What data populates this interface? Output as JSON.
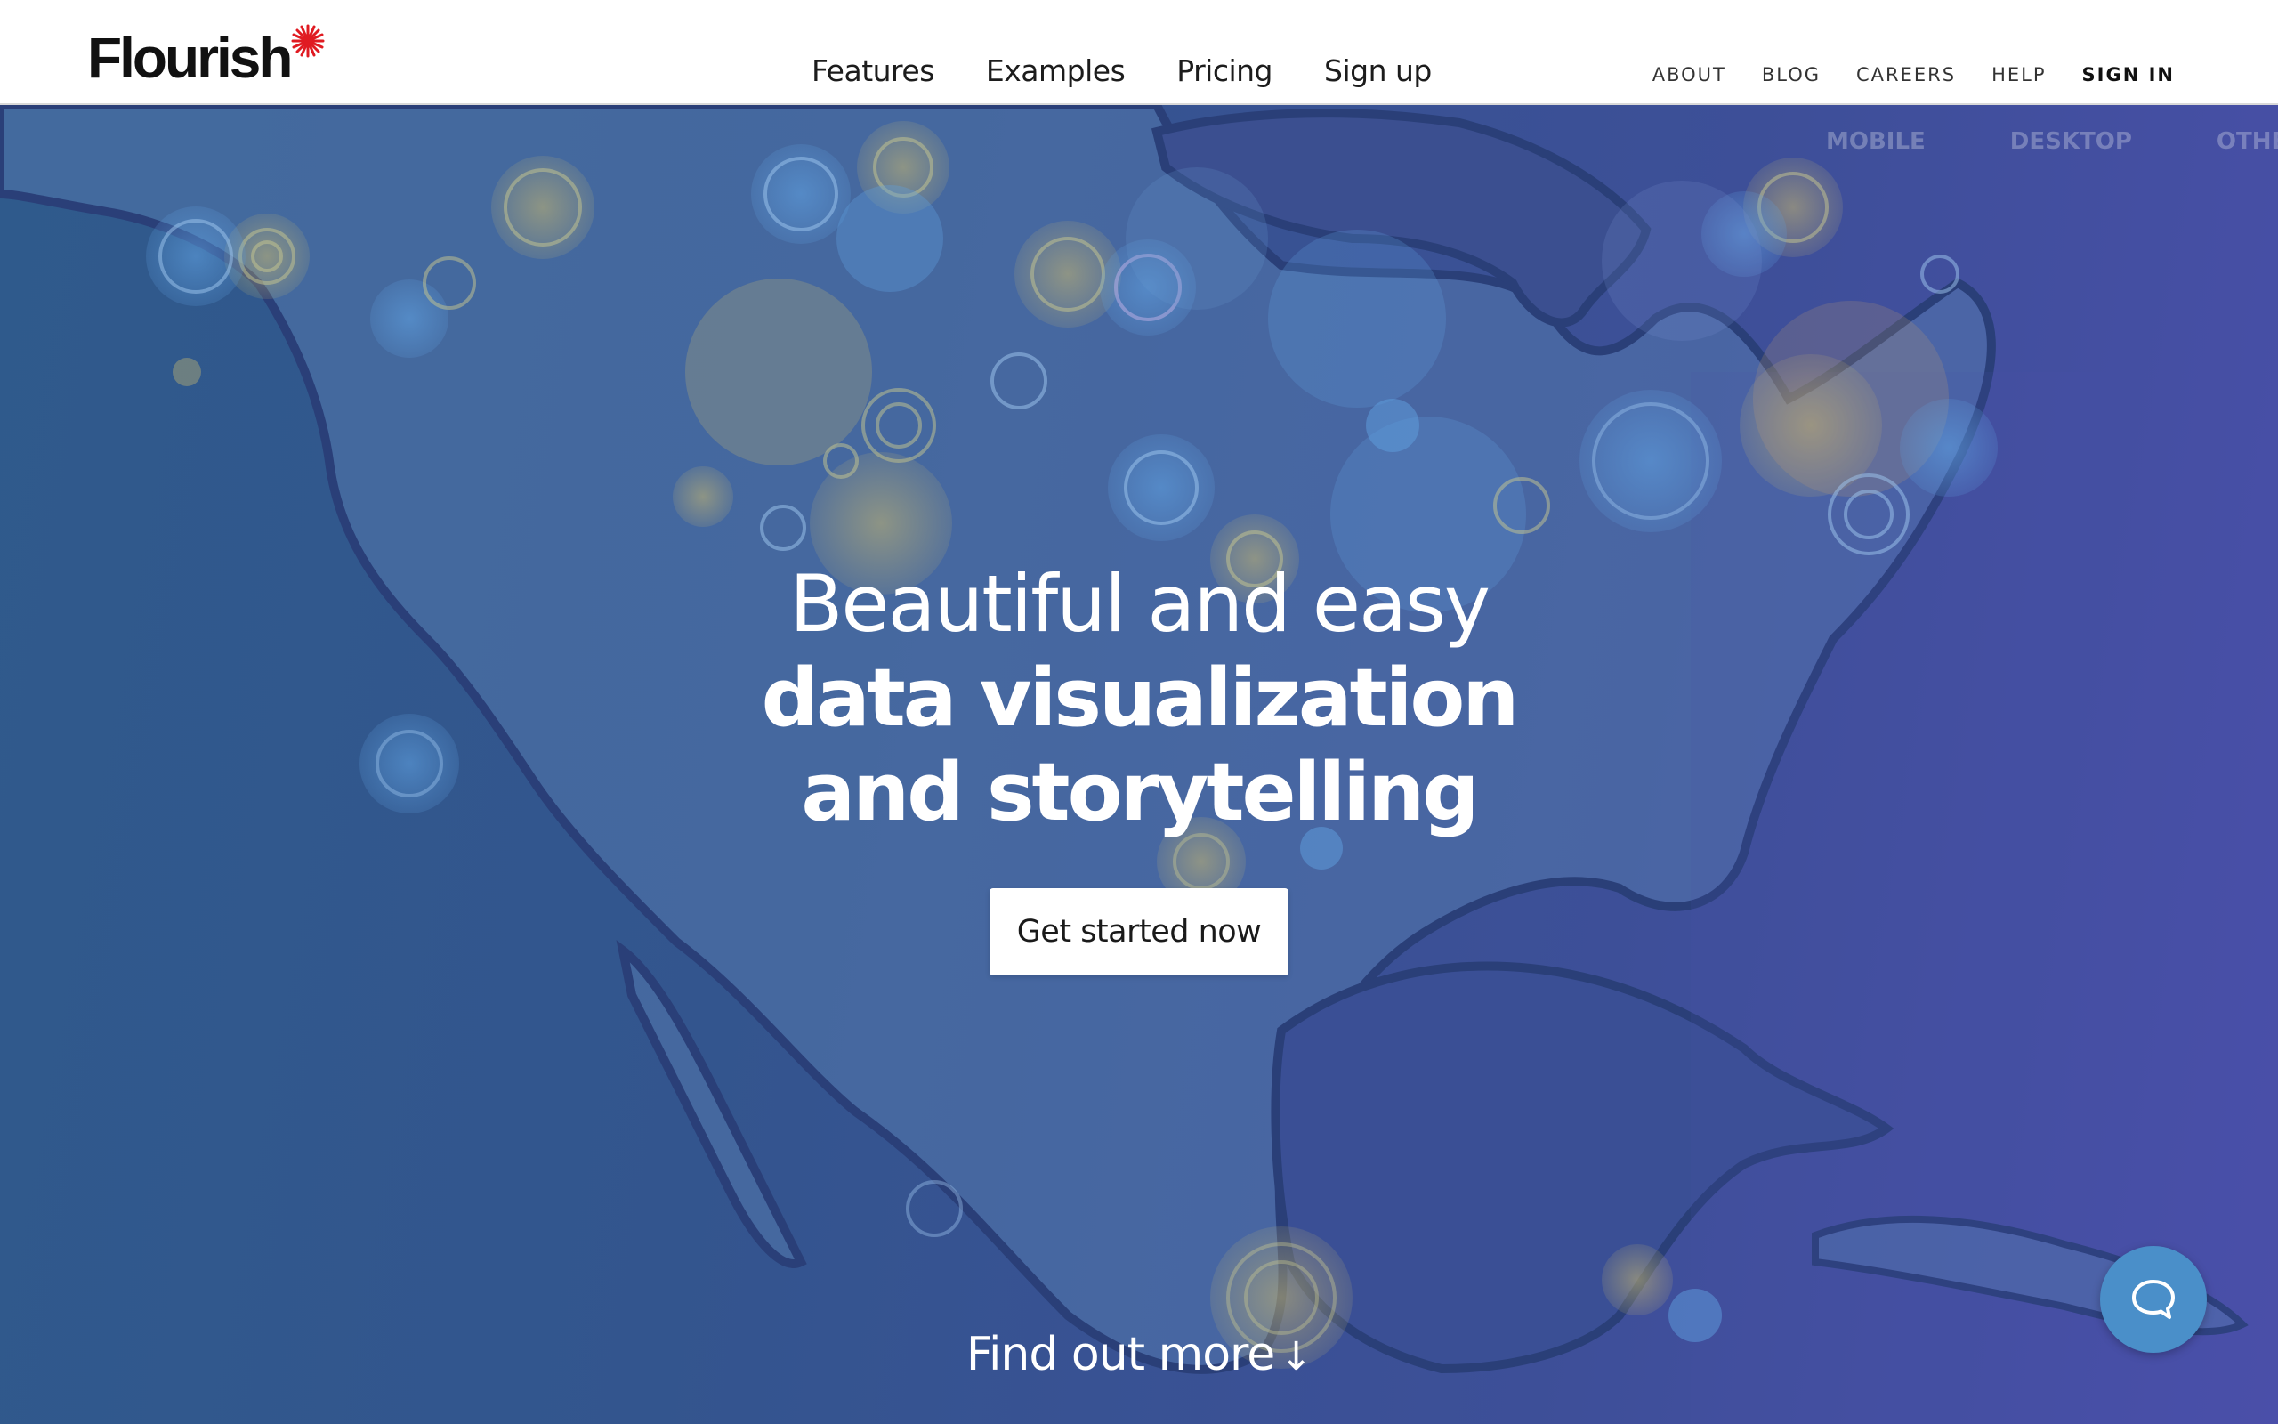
{
  "brand": {
    "name": "Flourish",
    "star_color": "#e01b22"
  },
  "main_nav": [
    {
      "label": "Features"
    },
    {
      "label": "Examples"
    },
    {
      "label": "Pricing"
    },
    {
      "label": "Sign up"
    }
  ],
  "util_nav": [
    {
      "label": "ABOUT"
    },
    {
      "label": "BLOG"
    },
    {
      "label": "CAREERS"
    },
    {
      "label": "HELP"
    },
    {
      "label": "SIGN IN"
    }
  ],
  "device_tabs": [
    "MOBILE",
    "DESKTOP",
    "OTHER"
  ],
  "hero": {
    "line1": "Beautiful and easy",
    "line2": "data visualization",
    "line3": "and storytelling",
    "cta_label": "Get started now",
    "find_more": "Find out more",
    "find_more_arrow": "↓"
  },
  "chat": {
    "icon": "chat-bubble-icon",
    "color": "#4a8fc9"
  },
  "colors": {
    "hero_bg_left": "#2f5a8c",
    "hero_bg_right": "#4a4faa",
    "land": "#5a7fb0"
  }
}
